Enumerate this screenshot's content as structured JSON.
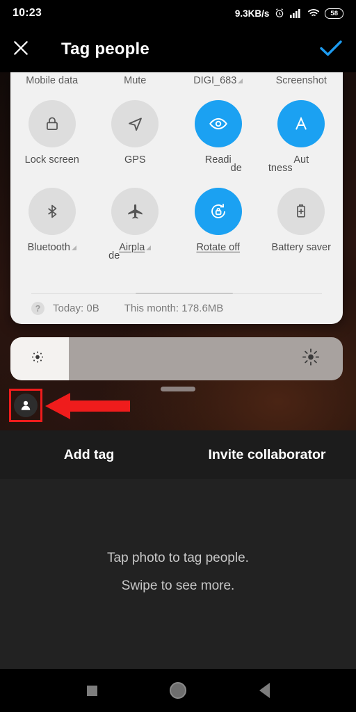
{
  "status_bar": {
    "time": "10:23",
    "network_speed": "9.3KB/s",
    "alarm_icon": "alarm-clock-icon",
    "signal_icon": "cellular-signal-icon",
    "wifi_icon": "wifi-icon",
    "battery_level": "58"
  },
  "app_bar": {
    "close_icon": "close-icon",
    "title": "Tag people",
    "done_icon": "checkmark-icon",
    "accent_color": "#1d9bf0"
  },
  "quick_settings": {
    "top_labels": [
      {
        "label": "Mobile data"
      },
      {
        "label": "Mute"
      },
      {
        "label": "DIGI_683",
        "has_signal_triangle": true
      },
      {
        "label": "Screenshot"
      }
    ],
    "row1": [
      {
        "label": "Lock screen",
        "icon": "lock-icon",
        "active": false
      },
      {
        "label": "GPS",
        "icon": "navigation-arrow-icon",
        "active": false
      },
      {
        "label": "Readi",
        "icon": "eye-icon",
        "active": true
      },
      {
        "label": "Aut",
        "icon": "auto-brightness-a-icon",
        "active": true
      }
    ],
    "row1_ghost_labels": [
      "",
      "",
      "de",
      "tness"
    ],
    "row2": [
      {
        "label": "Bluetooth",
        "icon": "bluetooth-icon",
        "active": false,
        "has_signal_triangle": true
      },
      {
        "label": "Airpla",
        "icon": "airplane-icon",
        "active": false,
        "underline": true,
        "has_signal_triangle": true
      },
      {
        "label": "Rotate off",
        "icon": "rotation-lock-icon",
        "active": true,
        "underline": true
      },
      {
        "label": "Battery saver",
        "icon": "battery-plus-icon",
        "active": false
      }
    ],
    "row2_ghost_labels": [
      "",
      "de",
      "",
      ""
    ],
    "data_usage": {
      "help_icon": "help-question-icon",
      "today": "Today: 0B",
      "month": "This month: 178.6MB"
    },
    "panel_color": "#f1f1f1",
    "active_tile_color": "#1ba1f2"
  },
  "brightness_slider": {
    "low_icon": "brightness-low-icon",
    "high_icon": "brightness-high-icon",
    "fill_percent": 18
  },
  "drag_handle": {
    "name": "panel-drag-handle"
  },
  "annotation": {
    "avatar_icon": "person-avatar-icon",
    "highlight_color": "#ef1c1c",
    "arrow_icon": "left-arrow-annotation"
  },
  "tabs": [
    {
      "label": "Add tag"
    },
    {
      "label": "Invite collaborator"
    }
  ],
  "hints": {
    "line1": "Tap photo to tag people.",
    "line2": "Swipe to see more."
  },
  "nav_bar": {
    "recents_icon": "recents-square-icon",
    "home_icon": "home-circle-icon",
    "back_icon": "back-triangle-icon"
  }
}
